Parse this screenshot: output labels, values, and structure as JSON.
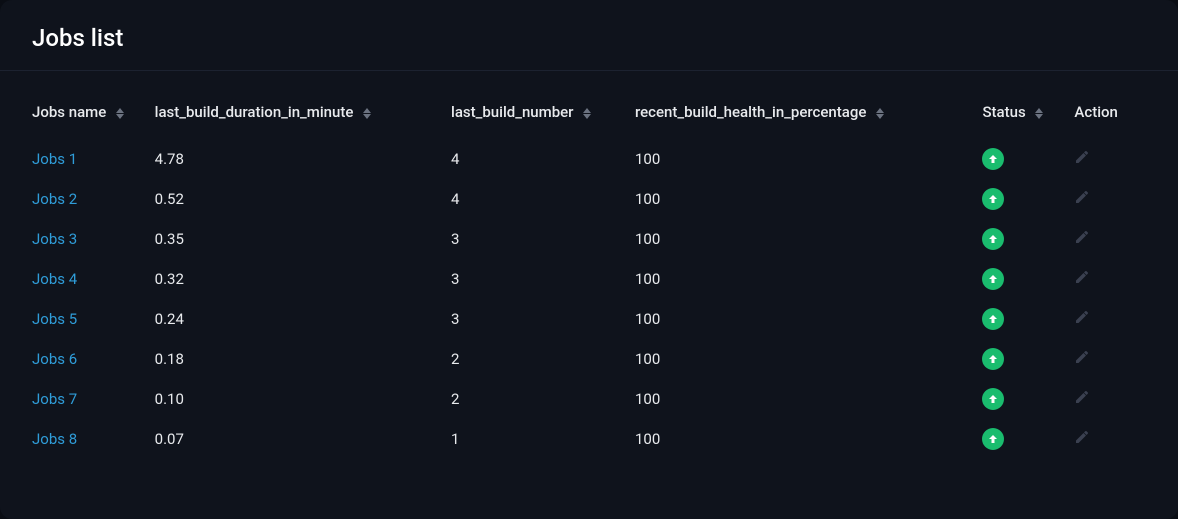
{
  "title": "Jobs list",
  "columns": {
    "name": "Jobs name",
    "duration": "last_build_duration_in_minute",
    "build_number": "last_build_number",
    "health": "recent_build_health_in_percentage",
    "status": "Status",
    "action": "Action"
  },
  "rows": [
    {
      "name": "Jobs 1",
      "duration": "4.78",
      "build_number": "4",
      "health": "100",
      "status": "up"
    },
    {
      "name": "Jobs 2",
      "duration": "0.52",
      "build_number": "4",
      "health": "100",
      "status": "up"
    },
    {
      "name": "Jobs 3",
      "duration": "0.35",
      "build_number": "3",
      "health": "100",
      "status": "up"
    },
    {
      "name": "Jobs 4",
      "duration": "0.32",
      "build_number": "3",
      "health": "100",
      "status": "up"
    },
    {
      "name": "Jobs 5",
      "duration": "0.24",
      "build_number": "3",
      "health": "100",
      "status": "up"
    },
    {
      "name": "Jobs 6",
      "duration": "0.18",
      "build_number": "2",
      "health": "100",
      "status": "up"
    },
    {
      "name": "Jobs 7",
      "duration": "0.10",
      "build_number": "2",
      "health": "100",
      "status": "up"
    },
    {
      "name": "Jobs 8",
      "duration": "0.07",
      "build_number": "1",
      "health": "100",
      "status": "up"
    }
  ],
  "colors": {
    "link": "#2f9dd9",
    "status_up_bg": "#1abc6e",
    "status_up_fg": "#ffffff",
    "action_icon": "#3a4050"
  }
}
